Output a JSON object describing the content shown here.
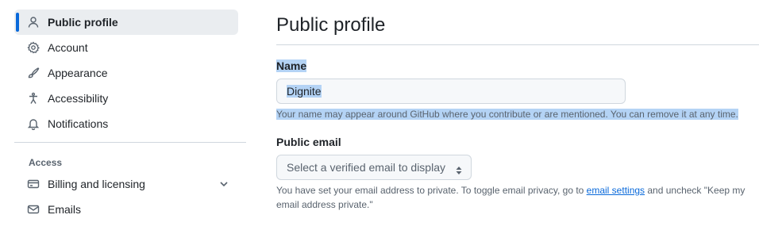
{
  "sidebar": {
    "items": [
      {
        "label": "Public profile",
        "icon": "person-icon",
        "active": true
      },
      {
        "label": "Account",
        "icon": "gear-icon"
      },
      {
        "label": "Appearance",
        "icon": "paintbrush-icon"
      },
      {
        "label": "Accessibility",
        "icon": "accessibility-icon"
      },
      {
        "label": "Notifications",
        "icon": "bell-icon"
      }
    ],
    "access_heading": "Access",
    "access_items": [
      {
        "label": "Billing and licensing",
        "icon": "credit-card-icon",
        "expandable": true
      },
      {
        "label": "Emails",
        "icon": "mail-icon"
      }
    ]
  },
  "main": {
    "title": "Public profile",
    "name": {
      "label": "Name",
      "value": "Dignite",
      "note": "Your name may appear around GitHub where you contribute or are mentioned. You can remove it at any time."
    },
    "public_email": {
      "label": "Public email",
      "selected": "Select a verified email to display",
      "note_before": "You have set your email address to private. To toggle email privacy, go to ",
      "note_link": "email settings",
      "note_after": " and uncheck \"Keep my email address private.\""
    }
  },
  "colors": {
    "accent": "#0969da",
    "selection": "#b4d3f5",
    "active_bg": "#eaedf0",
    "border": "#d0d7de",
    "muted_text": "#59636e"
  }
}
